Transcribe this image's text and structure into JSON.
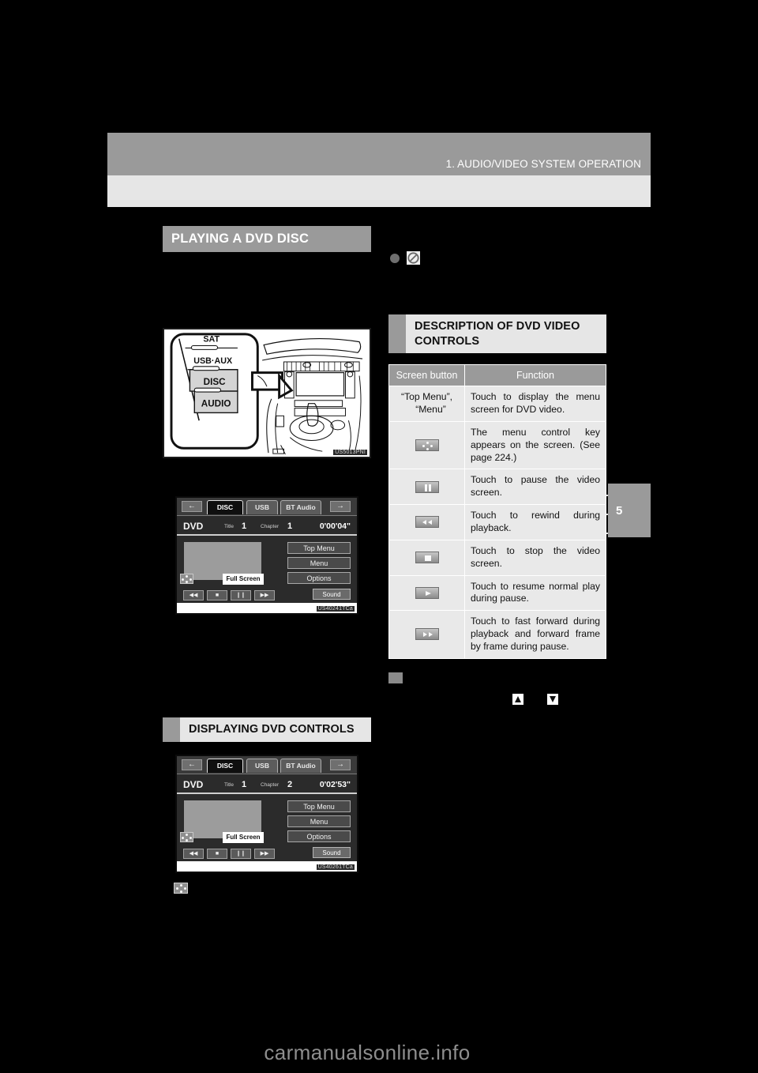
{
  "header": {
    "chapter_title": "1. AUDIO/VIDEO SYSTEM OPERATION",
    "page_tab_number": "5"
  },
  "left_column": {
    "section_heading": "PLAYING A DVD DISC",
    "dashboard_figure": {
      "buttons": [
        "SAT",
        "USB·AUX",
        "DISC",
        "AUDIO"
      ],
      "figure_id": "US5013PNI"
    },
    "screen_figure_1": {
      "figure_id": "US40241TCa",
      "nav_arrow_left": "←",
      "nav_arrow_right": "→",
      "tabs": [
        "DISC",
        "USB",
        "BT Audio"
      ],
      "selected_tab": "DISC",
      "source_label": "DVD",
      "title_label": "Title",
      "title_value": "1",
      "chapter_label": "Chapter",
      "chapter_value": "1",
      "time": "0'00'04\"",
      "side_buttons": [
        "Top Menu",
        "Menu",
        "Options"
      ],
      "fullscreen_button": "Full Screen",
      "transport_buttons": [
        "◀◀",
        "■",
        "❙❙",
        "▶▶"
      ],
      "sound_button": "Sound",
      "menu_control_key": "menu-control-key-icon"
    },
    "subsection_heading": "DISPLAYING DVD CONTROLS",
    "screen_figure_2": {
      "figure_id": "US40261TCa",
      "nav_arrow_left": "←",
      "nav_arrow_right": "→",
      "tabs": [
        "DISC",
        "USB",
        "BT Audio"
      ],
      "selected_tab": "DISC",
      "source_label": "DVD",
      "title_label": "Title",
      "title_value": "1",
      "chapter_label": "Chapter",
      "chapter_value": "2",
      "time": "0'02'53\"",
      "side_buttons": [
        "Top Menu",
        "Menu",
        "Options"
      ],
      "fullscreen_button": "Full Screen",
      "transport_buttons": [
        "◀◀",
        "■",
        "❙❙",
        "▶▶"
      ],
      "sound_button": "Sound",
      "menu_control_key": "menu-control-key-icon"
    },
    "menu_key_note_icon": "menu-control-key-icon"
  },
  "right_column": {
    "bullet_icon": "no-disc-icon",
    "section_heading": "DESCRIPTION OF DVD VIDEO CONTROLS",
    "table": {
      "columns": [
        "Screen button",
        "Function"
      ],
      "rows": [
        {
          "button_type": "text",
          "button_label": "“Top Menu”,\n“Menu”",
          "button_line1": "“Top Menu”,",
          "button_line2": "“Menu”",
          "icon_name": "",
          "function": "Touch to display the menu screen for DVD video."
        },
        {
          "button_type": "icon",
          "button_label": "",
          "icon_name": "menu-control-key-icon",
          "function": "The menu control key appears on the screen. (See page 224.)"
        },
        {
          "button_type": "icon",
          "button_label": "",
          "icon_name": "pause-icon",
          "function": "Touch to pause the video screen."
        },
        {
          "button_type": "icon",
          "button_label": "",
          "icon_name": "rewind-icon",
          "function": "Touch to rewind during playback."
        },
        {
          "button_type": "icon",
          "button_label": "",
          "icon_name": "stop-icon",
          "function": "Touch to stop the video screen."
        },
        {
          "button_type": "icon",
          "button_label": "",
          "icon_name": "play-icon",
          "function": "Touch to resume normal play during pause."
        },
        {
          "button_type": "icon",
          "button_label": "",
          "icon_name": "fast-forward-icon",
          "function": "Touch to fast forward during playback and forward frame by frame during pause."
        }
      ]
    },
    "sub_marker_icon": "section-marker",
    "arrow_icons": [
      "up-arrow-icon",
      "down-arrow-icon"
    ]
  },
  "footer": {
    "watermark": "carmanualsonline.info"
  },
  "colors": {
    "band_gray": "#9a9a9a",
    "light_gray": "#e6e6e6",
    "table_cell": "#e9e9e9",
    "page_black": "#000000"
  }
}
